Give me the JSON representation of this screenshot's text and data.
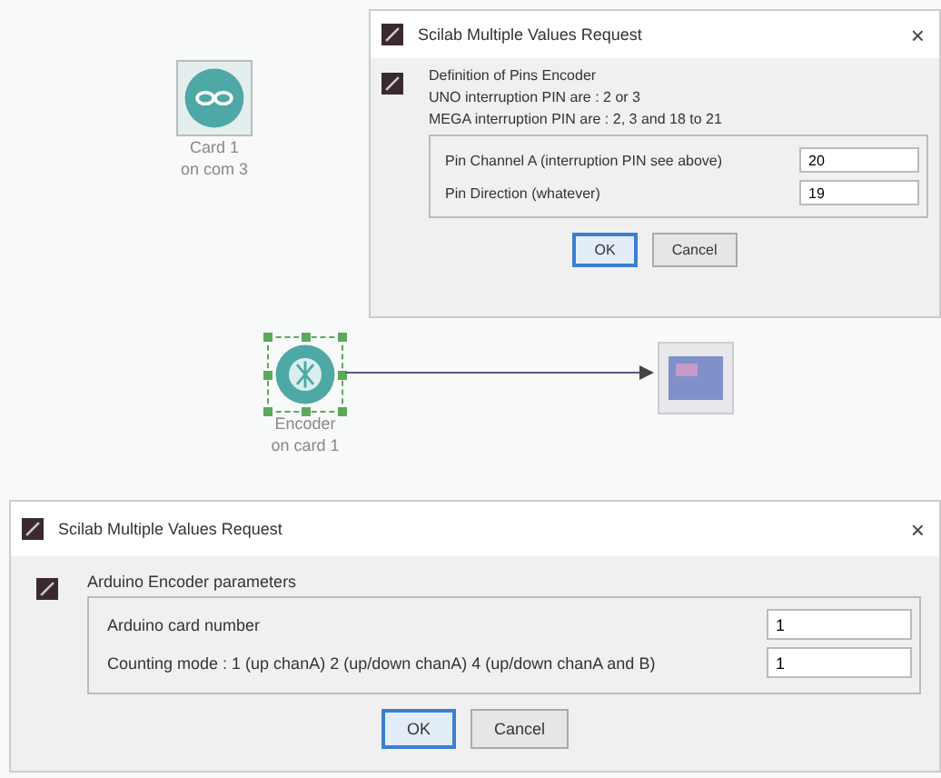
{
  "diagram": {
    "blocks": [
      {
        "kind": "card",
        "selected": false,
        "label": [
          "Card 1",
          "on com 3"
        ]
      },
      {
        "kind": "encoder",
        "selected": true,
        "label": [
          "Encoder",
          "on card 1"
        ]
      },
      {
        "kind": "scope",
        "selected": false
      }
    ]
  },
  "dialogs": [
    {
      "title": "Scilab Multiple Values Request",
      "close": "×",
      "description": [
        "Definition of Pins Encoder",
        "UNO interruption PIN are : 2 or 3",
        "MEGA interruption PIN are : 2, 3 and 18 to 21"
      ],
      "fields": [
        {
          "label": "Pin Channel A (interruption PIN see above)",
          "value": "20"
        },
        {
          "label": "Pin Direction (whatever)",
          "value": "19"
        }
      ],
      "buttons": [
        {
          "label": "OK",
          "default": true
        },
        {
          "label": "Cancel",
          "default": false
        }
      ]
    },
    {
      "title": "Scilab Multiple Values Request",
      "close": "×",
      "description": [
        "Arduino Encoder parameters"
      ],
      "fields": [
        {
          "label": "Arduino card number",
          "value": "1"
        },
        {
          "label": "Counting mode : 1 (up chanA) 2 (up/down chanA) 4 (up/down chanA and B)",
          "value": "1"
        }
      ],
      "buttons": [
        {
          "label": "OK",
          "default": true
        },
        {
          "label": "Cancel",
          "default": false
        }
      ]
    }
  ]
}
